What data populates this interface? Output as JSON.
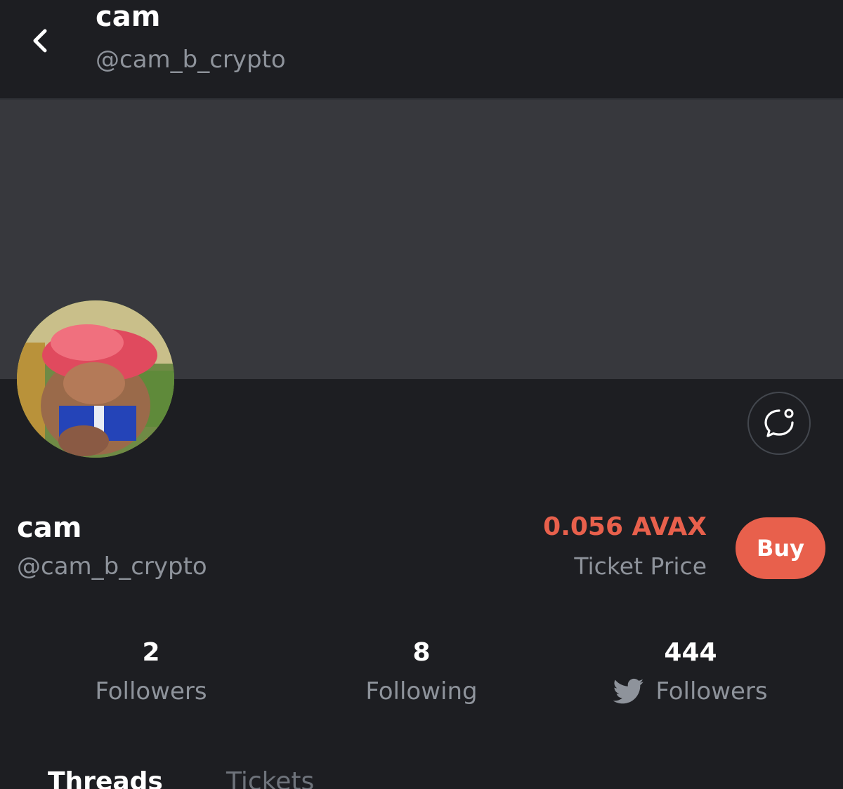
{
  "header": {
    "name": "cam",
    "handle": "@cam_b_crypto",
    "back_icon": "chevron-left-icon"
  },
  "profile": {
    "name": "cam",
    "handle": "@cam_b_crypto",
    "avatar": "cartoon character avatar",
    "chat_icon": "chat-bubble-icon"
  },
  "ticket": {
    "price": "0.056 AVAX",
    "label": "Ticket Price",
    "buy_label": "Buy"
  },
  "stats": [
    {
      "value": "2",
      "label": "Followers"
    },
    {
      "value": "8",
      "label": "Following"
    },
    {
      "value": "444",
      "label": "Followers",
      "icon": "twitter-bird-icon"
    }
  ],
  "tabs": [
    {
      "label": "Threads",
      "active": true
    },
    {
      "label": "Tickets",
      "active": false
    }
  ],
  "colors": {
    "background": "#1d1e22",
    "banner": "#37383d",
    "accent": "#e8604c",
    "muted_text": "#8e939b"
  }
}
